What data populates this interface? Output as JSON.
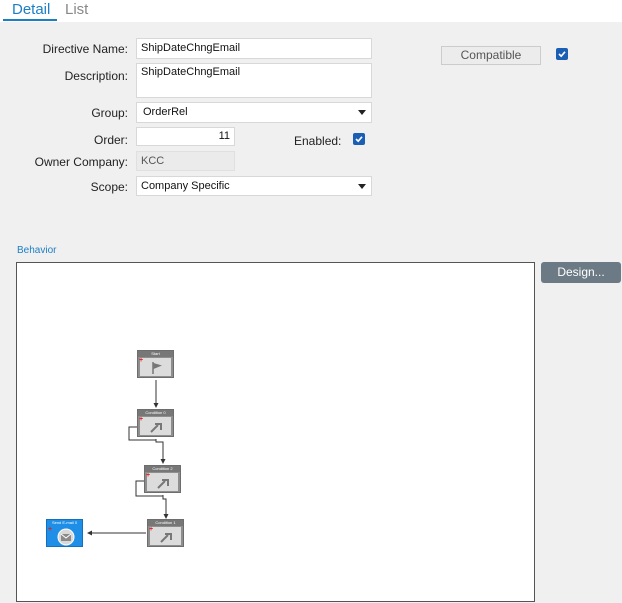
{
  "tabs": {
    "detail": "Detail",
    "list": "List"
  },
  "form": {
    "directive_name": {
      "label": "Directive Name:",
      "value": "ShipDateChngEmail"
    },
    "description": {
      "label": "Description:",
      "value": "ShipDateChngEmail"
    },
    "group": {
      "label": "Group:",
      "value": "OrderRel"
    },
    "order": {
      "label": "Order:",
      "value": "11"
    },
    "enabled": {
      "label": "Enabled:",
      "checked": true
    },
    "owner_company": {
      "label": "Owner Company:",
      "value": "KCC"
    },
    "scope": {
      "label": "Scope:",
      "value": "Company Specific"
    },
    "compatible": {
      "label": "Compatible",
      "checked": true
    }
  },
  "behavior": {
    "label": "Behavior",
    "design_button": "Design...",
    "nodes": [
      {
        "title": "Start",
        "kind": "start",
        "icon": "flag-icon"
      },
      {
        "title": "Condition 0",
        "kind": "condition",
        "icon": "condition-icon"
      },
      {
        "title": "Condition 2",
        "kind": "condition",
        "icon": "condition-icon"
      },
      {
        "title": "Condition 1",
        "kind": "condition",
        "icon": "condition-icon"
      },
      {
        "title": "Send E-mail 0",
        "kind": "email",
        "icon": "email-icon"
      }
    ]
  },
  "colors": {
    "accent": "#1b7fc4",
    "checkbox": "#1a5fb4",
    "design_button": "#6c7a85",
    "email_node": "#1e8ee6"
  }
}
